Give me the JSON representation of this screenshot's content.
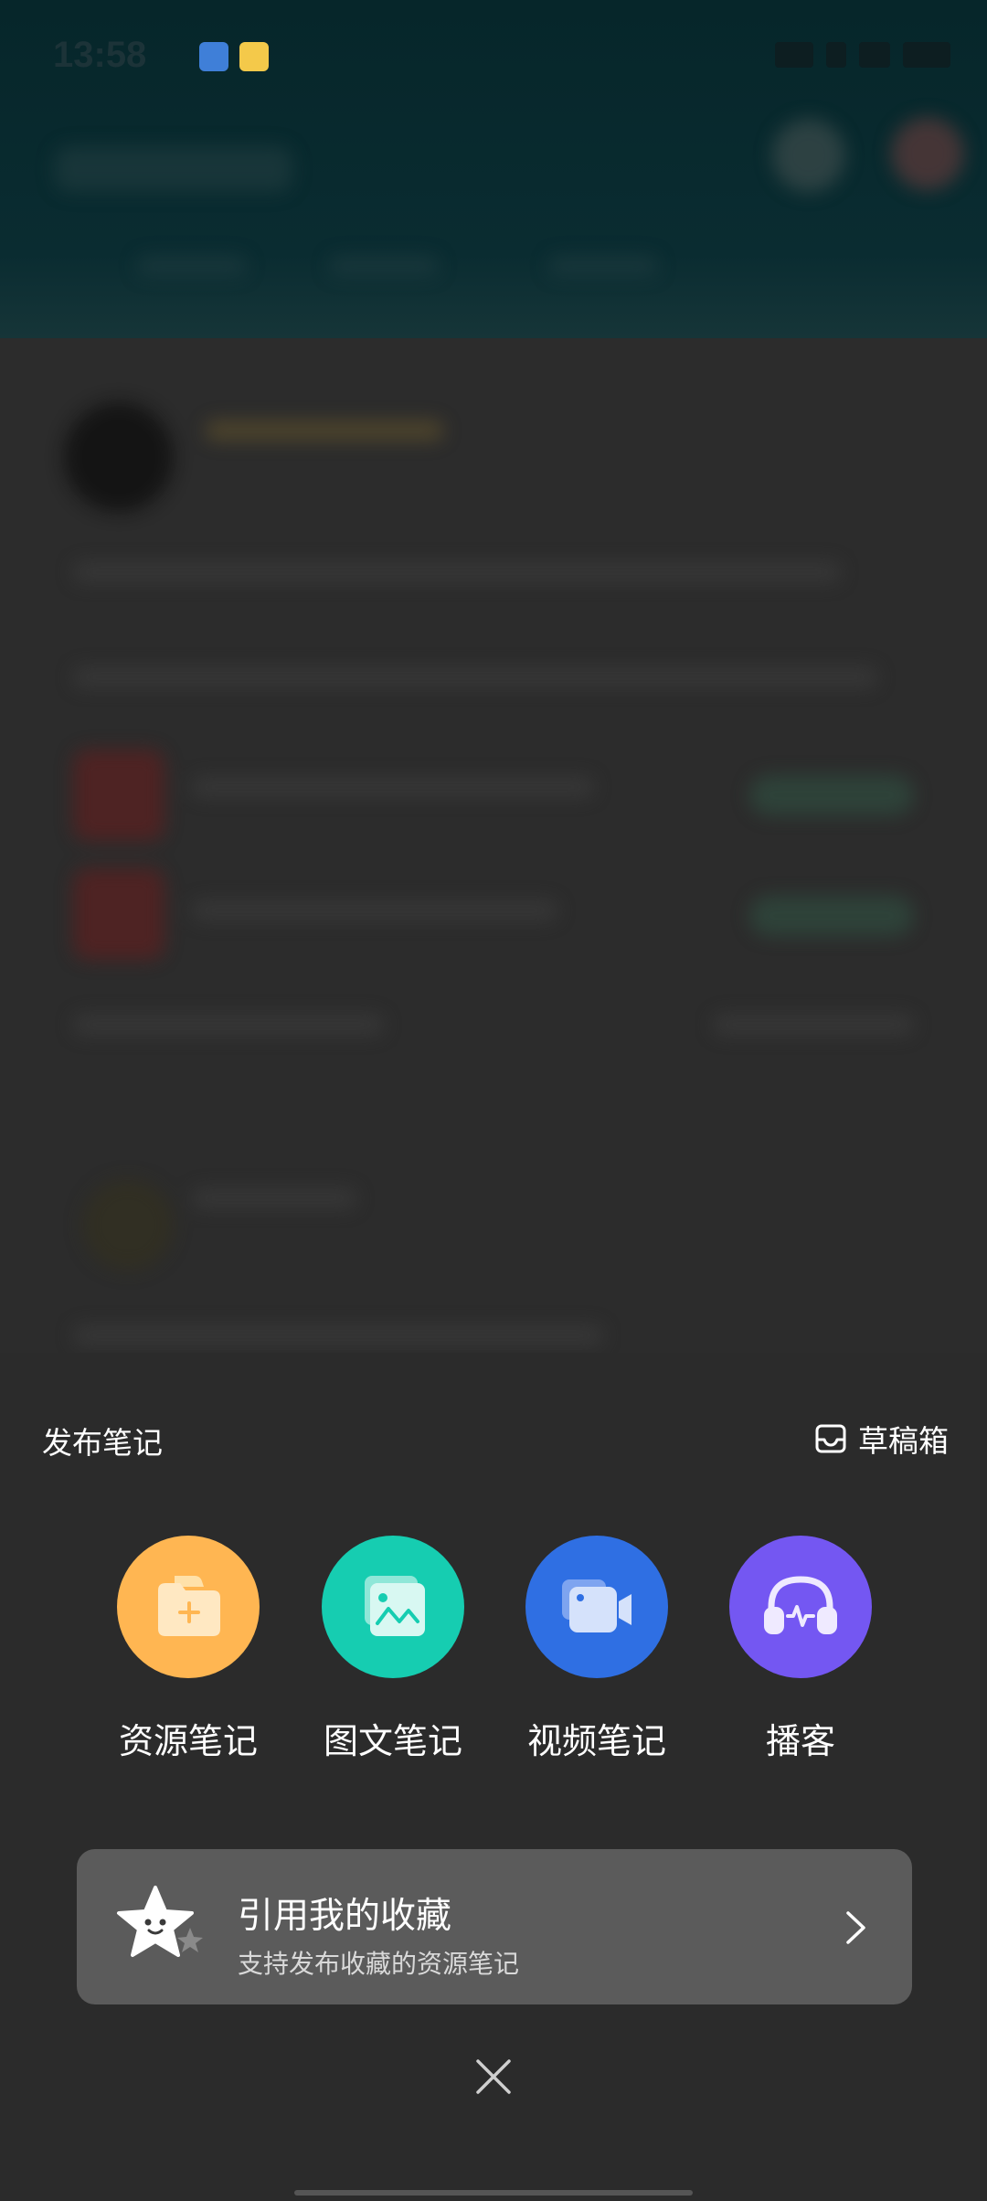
{
  "status_bar": {
    "time": "13:58"
  },
  "sheet": {
    "title": "发布笔记",
    "drafts_label": "草稿箱",
    "actions": [
      {
        "label": "资源笔记",
        "icon": "resource-folder-icon",
        "color": "#ffb652"
      },
      {
        "label": "图文笔记",
        "icon": "image-text-icon",
        "color": "#16cdb1"
      },
      {
        "label": "视频笔记",
        "icon": "video-camera-icon",
        "color": "#2f6fe3"
      },
      {
        "label": "播客",
        "icon": "podcast-headphones-icon",
        "color": "#7457f2"
      }
    ],
    "favorites": {
      "title": "引用我的收藏",
      "subtitle": "支持发布收藏的资源笔记"
    }
  },
  "colors": {
    "sheet_background": "#2c2c2c",
    "card_background": "#5b5b5b",
    "header_teal": "#0a2c31"
  }
}
